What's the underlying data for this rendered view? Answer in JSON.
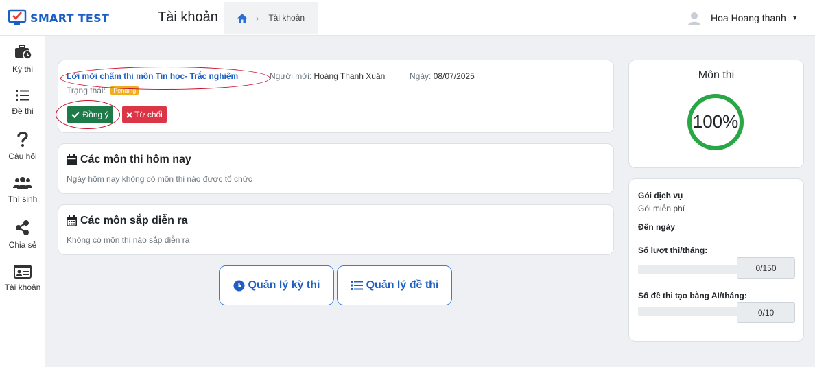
{
  "header": {
    "brand": "SMART TEST",
    "page_title": "Tài khoản",
    "breadcrumb_current": "Tài khoản",
    "user_name": "Hoa Hoang thanh"
  },
  "sidebar": {
    "items": [
      {
        "label": "Kỳ thi",
        "icon": "briefcase-clock-icon"
      },
      {
        "label": "Đề thi",
        "icon": "list-icon"
      },
      {
        "label": "Câu hỏi",
        "icon": "question-icon"
      },
      {
        "label": "Thí sinh",
        "icon": "users-icon"
      },
      {
        "label": "Chia sẻ",
        "icon": "share-icon"
      },
      {
        "label": "Tài khoản",
        "icon": "id-card-icon"
      }
    ]
  },
  "invitation": {
    "title": "Lời mời chấm thi môn Tin học- Trắc nghiệm",
    "inviter_label": "Người mời:",
    "inviter": "Hoàng Thanh Xuân",
    "date_label": "Ngày:",
    "date": "08/07/2025",
    "status_label": "Trạng thái:",
    "status": "Pending",
    "accept_label": "Đồng ý",
    "reject_label": "Từ chối"
  },
  "today": {
    "title": "Các môn thi hôm nay",
    "empty_text": "Ngày hôm nay không có môn thi nào được tổ chức"
  },
  "upcoming": {
    "title": "Các môn sắp diễn ra",
    "empty_text": "Không có môn thi nào sắp diễn ra"
  },
  "actions": {
    "manage_exams": "Quản lý kỳ thi",
    "manage_tests": "Quản lý đề thi"
  },
  "subjects": {
    "title": "Môn thi",
    "percent_text": "100%",
    "percent_value": 100
  },
  "service": {
    "package_label": "Gói dịch vụ",
    "package_value": "Gói miễn phí",
    "until_label": "Đến ngày",
    "monthly_label": "Số lượt thi/tháng:",
    "monthly_value": "0/150",
    "monthly_fraction": 0,
    "ai_label": "Số đề thi tạo bằng AI/tháng:",
    "ai_value": "0/10",
    "ai_fraction": 0
  },
  "colors": {
    "brand": "#1c5fc4",
    "accept": "#1f7a4a",
    "reject": "#dc3545",
    "ring": "#28a745",
    "badge": "#f0ad1e"
  }
}
